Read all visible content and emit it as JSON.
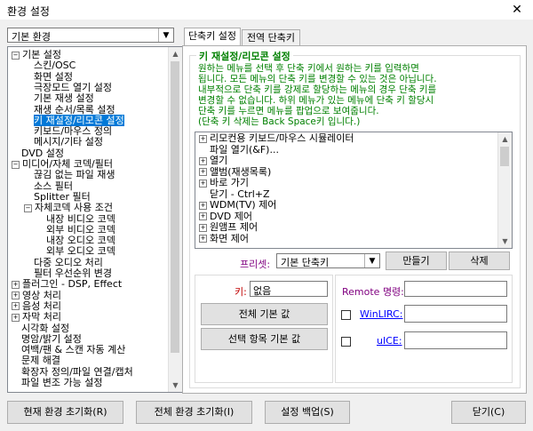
{
  "window": {
    "title": "환경 설정",
    "close_label": "✕"
  },
  "category_select": {
    "value": "기본 환경"
  },
  "tabs": [
    {
      "label": "단축키 설정"
    },
    {
      "label": "전역 단축키"
    }
  ],
  "tree": [
    {
      "label": "기본 설정",
      "level": 0,
      "expander": "−"
    },
    {
      "label": "스킨/OSC",
      "level": 1
    },
    {
      "label": "화면 설정",
      "level": 1
    },
    {
      "label": "극장모드 열기 설정",
      "level": 1
    },
    {
      "label": "기본 재생 설정",
      "level": 1
    },
    {
      "label": "재생 순서/목록 설정",
      "level": 1
    },
    {
      "label": "키 재설정/리모콘 설정",
      "level": 1,
      "selected": true
    },
    {
      "label": "키보드/마우스 정의",
      "level": 1
    },
    {
      "label": "메시지/기타 설정",
      "level": 1
    },
    {
      "label": "DVD 설정",
      "level": 0
    },
    {
      "label": "미디어/자체 코덱/필터",
      "level": 0,
      "expander": "−"
    },
    {
      "label": "끊김 없는 파일 재생",
      "level": 1
    },
    {
      "label": "소스 필터",
      "level": 1
    },
    {
      "label": "Splitter 필터",
      "level": 1
    },
    {
      "label": "자체코덱 사용 조건",
      "level": 1,
      "expander": "−"
    },
    {
      "label": "내장 비디오 코덱",
      "level": 2
    },
    {
      "label": "외부 비디오 코덱",
      "level": 2
    },
    {
      "label": "내장 오디오 코덱",
      "level": 2
    },
    {
      "label": "외부 오디오 코덱",
      "level": 2
    },
    {
      "label": "다중 오디오 처리",
      "level": 1
    },
    {
      "label": "필터 우선순위 변경",
      "level": 1
    },
    {
      "label": "플러그인 - DSP, Effect",
      "level": 0,
      "expander": "+"
    },
    {
      "label": "영상 처리",
      "level": 0,
      "expander": "+"
    },
    {
      "label": "음성 처리",
      "level": 0,
      "expander": "+"
    },
    {
      "label": "자막 처리",
      "level": 0,
      "expander": "+"
    },
    {
      "label": "시각화 설정",
      "level": 0
    },
    {
      "label": "명암/밝기 설정",
      "level": 0
    },
    {
      "label": "여백/팬 & 스캔 자동 계산",
      "level": 0
    },
    {
      "label": "문제 해결",
      "level": 0
    },
    {
      "label": "확장자 정의/파일 연결/캡처",
      "level": 0
    },
    {
      "label": "파일 변조 가능 설정",
      "level": 0
    }
  ],
  "group": {
    "title": "키 재설정/리모콘 설정",
    "description": "원하는 메뉴를 선택 후 단축 키에서 원하는 키를 입력하면\n됩니다. 모든 메뉴의 단축 키를 변경할 수 있는 것은 아닙니다.\n내부적으로 단축 키를 강제로 할당하는 메뉴의 경우 단축 키를\n변경할 수 없습니다. 하위 메뉴가 있는 메뉴에 단축 키 할당시\n단축 키를 누르면 메뉴를 팝업으로 보여줍니다.\n(단축 키 삭제는 Back Space키 입니다.)"
  },
  "menu_list": [
    {
      "label": "리모컨용 키보드/마우스 시뮬레이터",
      "expander": "+"
    },
    {
      "label": "파일 열기(&F)...",
      "expander": ""
    },
    {
      "label": "열기",
      "expander": "+"
    },
    {
      "label": "앨범(재생목록)",
      "expander": "+"
    },
    {
      "label": "바로 가기",
      "expander": "+"
    },
    {
      "label": "닫기 - Ctrl+Z",
      "expander": ""
    },
    {
      "label": "WDM(TV) 제어",
      "expander": "+"
    },
    {
      "label": "DVD 제어",
      "expander": "+"
    },
    {
      "label": "원앰프 제어",
      "expander": "+"
    },
    {
      "label": "화면 제어",
      "expander": "+"
    }
  ],
  "preset": {
    "label": "프리셋:",
    "value": "기본 단축키",
    "make_label": "만들기",
    "delete_label": "삭제"
  },
  "key": {
    "label": "키:",
    "value": "없음",
    "reset_all_label": "전체 기본 값",
    "reset_selected_label": "선택 항목 기본 값"
  },
  "remote": {
    "label": "Remote 명령:",
    "winlirc_label": "WinLIRC:",
    "uice_label": "uICE:"
  },
  "footer": {
    "reset_current_label": "현재 환경 초기화(R)",
    "reset_all_label": "전체 환경 초기화(I)",
    "backup_label": "설정 백업(S)",
    "close_label": "닫기(C)"
  },
  "colors": {
    "accent": "#0078d7",
    "group_text": "#008000",
    "label_red": "#c00000",
    "label_purple": "#800080",
    "link_blue": "#0000ff"
  }
}
